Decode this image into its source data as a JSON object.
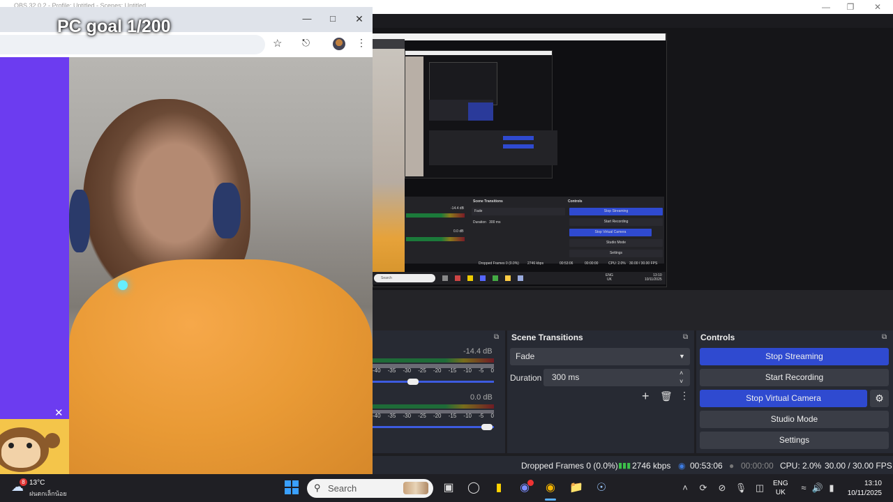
{
  "obs": {
    "title": "OBS 32.0.2 - Profile: Untitled - Scenes: Untitled",
    "mixer": {
      "tracks": [
        {
          "db": "-14.4 dB",
          "scale": [
            "-40",
            "-35",
            "-30",
            "-25",
            "-20",
            "-15",
            "-10",
            "-5",
            "0"
          ]
        },
        {
          "db": "0.0 dB",
          "scale": [
            "-40",
            "-35",
            "-30",
            "-25",
            "-20",
            "-15",
            "-10",
            "-5",
            "0"
          ]
        }
      ]
    },
    "transitions": {
      "title": "Scene Transitions",
      "selected": "Fade",
      "duration_label": "Duration",
      "duration_value": "300 ms"
    },
    "controls": {
      "title": "Controls",
      "buttons": [
        "Stop Streaming",
        "Start Recording",
        "Stop Virtual Camera",
        "Studio Mode",
        "Settings"
      ]
    },
    "status": {
      "dropped": "Dropped Frames 0 (0.0%)",
      "bitrate": "2746 kbps",
      "live_time": "00:53:06",
      "rec_time": "00:00:00",
      "cpu": "CPU: 2.0%",
      "fps": "30.00 / 30.00 FPS"
    },
    "nested": {
      "search": "Search",
      "status_dropped": "Dropped Frames 0 (0.0%)",
      "status_bitrate": "2746 kbps",
      "status_live": "00:53:06",
      "status_rec": "00:00:00",
      "status_cpu": "CPU: 2.0%",
      "status_fps": "30.00 / 30.00 FPS",
      "tray_lang": "ENG",
      "tray_region": "UK",
      "tray_time": "13:10",
      "tray_date": "10/11/2025"
    }
  },
  "overlay": {
    "goal_text": "PC goal 1/200"
  },
  "taskbar": {
    "weather_temp": "13°C",
    "weather_desc": "ฝนตกเล็กน้อย",
    "weather_badge": "8",
    "search_placeholder": "Search",
    "lang": "ENG",
    "region": "UK",
    "time": "13:10",
    "date": "10/11/2025"
  },
  "colors": {
    "accent_blue": "#2f4ad0",
    "purple_bg": "#6c3cf0",
    "live_green": "#3cc04a"
  }
}
